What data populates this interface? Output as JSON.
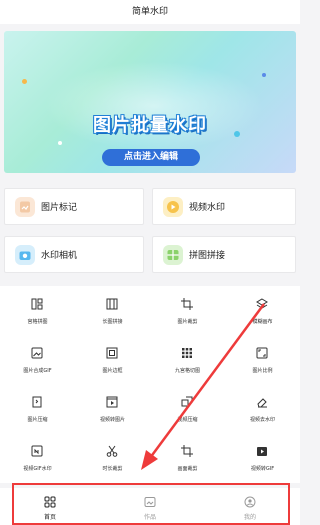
{
  "app": {
    "title": "简单水印"
  },
  "banner": {
    "title": "图片批量水印",
    "button": "点击进入编辑"
  },
  "cards": [
    {
      "label": "图片标记",
      "icon": "image-mark-icon",
      "color": "#f3c9a5"
    },
    {
      "label": "视频水印",
      "icon": "video-watermark-icon",
      "color": "#f7c34b"
    },
    {
      "label": "水印相机",
      "icon": "camera-icon",
      "color": "#58b8ef"
    },
    {
      "label": "拼图拼接",
      "icon": "collage-icon",
      "color": "#8ad26a"
    }
  ],
  "tools": [
    {
      "label": "宫格拼图",
      "icon": "grid-collage-icon"
    },
    {
      "label": "长图拼接",
      "icon": "long-image-icon"
    },
    {
      "label": "图片裁剪",
      "icon": "crop-icon"
    },
    {
      "label": "模糊画布",
      "icon": "layers-icon"
    },
    {
      "label": "图片合成GIF",
      "icon": "image-gif-icon"
    },
    {
      "label": "图片边框",
      "icon": "border-icon"
    },
    {
      "label": "九宫格切图",
      "icon": "nine-grid-icon"
    },
    {
      "label": "图片比例",
      "icon": "ratio-icon"
    },
    {
      "label": "图片压缩",
      "icon": "compress-icon"
    },
    {
      "label": "视频转图片",
      "icon": "video-to-image-icon"
    },
    {
      "label": "视频压缩",
      "icon": "video-compress-icon"
    },
    {
      "label": "视频去水印",
      "icon": "eraser-icon"
    },
    {
      "label": "视频GIF水印",
      "icon": "gif-watermark-icon"
    },
    {
      "label": "时长裁剪",
      "icon": "scissors-icon"
    },
    {
      "label": "画面裁剪",
      "icon": "frame-crop-icon"
    },
    {
      "label": "视频转GIF",
      "icon": "video-gif-icon"
    }
  ],
  "nav": [
    {
      "label": "首页",
      "icon": "home-grid-icon",
      "active": true
    },
    {
      "label": "作品",
      "icon": "works-icon",
      "active": false
    },
    {
      "label": "我的",
      "icon": "profile-icon",
      "active": false
    }
  ],
  "annotation": {
    "highlight_color": "#ee3b3b"
  }
}
